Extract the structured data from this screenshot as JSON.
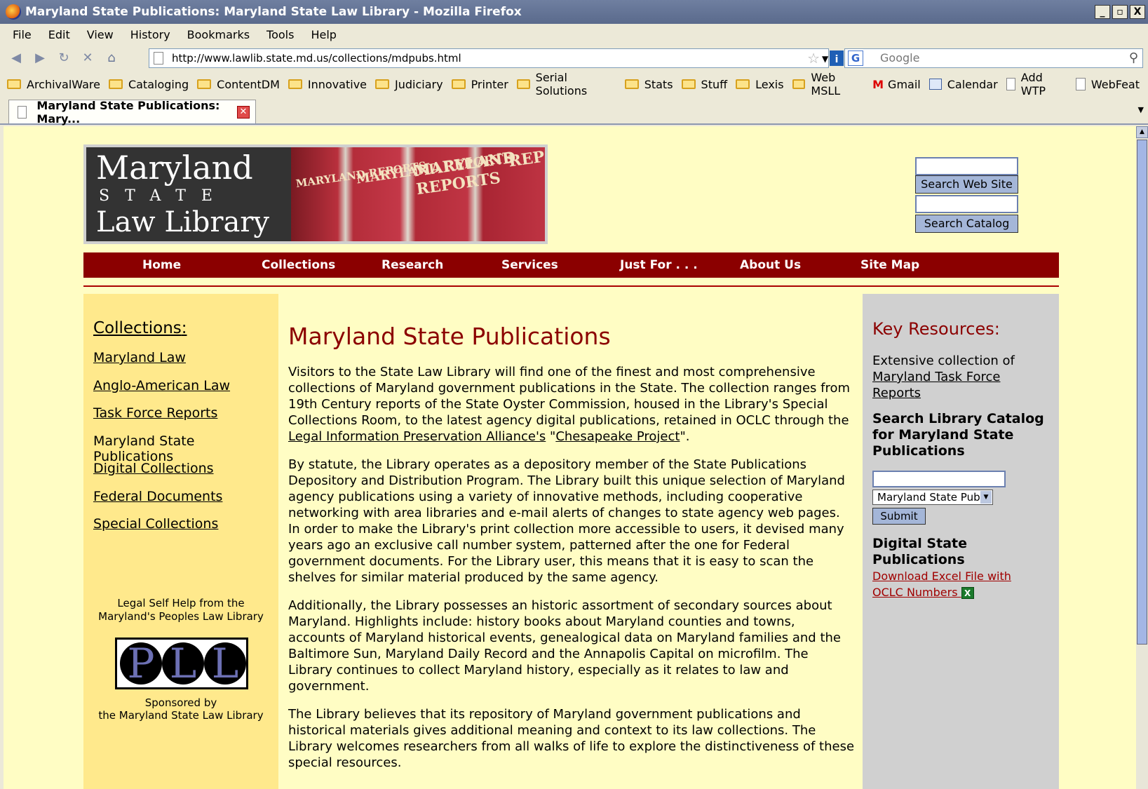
{
  "window": {
    "title": "Maryland State Publications: Maryland State Law Library - Mozilla Firefox",
    "controls": [
      "_",
      "▫",
      "X"
    ]
  },
  "menu": [
    "File",
    "Edit",
    "View",
    "History",
    "Bookmarks",
    "Tools",
    "Help"
  ],
  "nav": {
    "url": "http://www.lawlib.state.md.us/collections/mdpubs.html",
    "search_placeholder": "Google",
    "search_engine_icon": "G"
  },
  "bookmarks": [
    {
      "label": "ArchivalWare",
      "icon": "folder-icon"
    },
    {
      "label": "Cataloging",
      "icon": "folder-icon"
    },
    {
      "label": "ContentDM",
      "icon": "folder-icon"
    },
    {
      "label": "Innovative",
      "icon": "folder-icon"
    },
    {
      "label": "Judiciary",
      "icon": "folder-icon"
    },
    {
      "label": "Printer",
      "icon": "folder-icon"
    },
    {
      "label": "Serial Solutions",
      "icon": "folder-icon"
    },
    {
      "label": "Stats",
      "icon": "folder-icon"
    },
    {
      "label": "Stuff",
      "icon": "folder-icon"
    },
    {
      "label": "Lexis",
      "icon": "folder-icon"
    },
    {
      "label": "Web MSLL",
      "icon": "folder-icon"
    },
    {
      "label": "Gmail",
      "icon": "gmail-icon"
    },
    {
      "label": "Calendar",
      "icon": "calendar-icon"
    },
    {
      "label": "Add WTP",
      "icon": "page-icon"
    },
    {
      "label": "WebFeat",
      "icon": "page-icon"
    }
  ],
  "tab": {
    "title": "Maryland State Publications: Mary..."
  },
  "site": {
    "logo": {
      "line1": "Maryland",
      "line2": "STATE",
      "line3": "Law Library",
      "spine1": "MARYLAND REPORTS",
      "spine2": "MARYLAND REPORTS",
      "spine3": "MARYLAND REPORTS",
      "spine4": "REP"
    },
    "search_web_button": "Search Web Site",
    "search_catalog_button": "Search Catalog",
    "nav": [
      "Home",
      "Collections",
      "Research",
      "Services",
      "Just For . . .",
      "About Us",
      "Site Map"
    ],
    "left": {
      "heading": "Collections",
      "heading_colon": ":",
      "links": [
        "Maryland Law",
        "Anglo-American Law",
        "Task Force Reports",
        "Maryland State Publications",
        "Digital Collections",
        "Federal Documents",
        "Special Collections"
      ],
      "pll_caption": "Legal Self Help from the Maryland's Peoples Law Library",
      "pll_logo": "PLL",
      "sponsor_line1": "Sponsored by",
      "sponsor_line2": "the Maryland State Law Library"
    },
    "main": {
      "title": "Maryland State Publications",
      "p1_a": "Visitors to the State Law Library will find one of the finest and most comprehensive collections of Maryland government publications in the State. The collection ranges from 19th Century reports of the State Oyster Commission, housed in the Library's Special Collections Room, to the latest agency digital publications, retained in OCLC through the ",
      "p1_link1": "Legal Information Preservation Alliance's",
      "p1_b": " \"",
      "p1_link2": "Chesapeake Project",
      "p1_c": "\".",
      "p2": "By statute, the Library operates as a depository member of the State Publications Depository and Distribution Program. The Library built this unique selection of Maryland agency publications using a variety of innovative methods, including cooperative networking with area libraries and e-mail alerts of changes to state agency web pages. In order to make the Library's print collection more accessible to users, it devised many years ago an exclusive call number system, patterned after the one for Federal government documents. For the Library user, this means that it is easy to scan the shelves for similar material produced by the same agency.",
      "p3": "Additionally, the Library possesses an historic assortment of secondary sources about Maryland. Highlights include: history books about Maryland counties and towns, accounts of Maryland historical events, genealogical data on Maryland families and the Baltimore Sun, Maryland Daily Record and the Annapolis Capital on microfilm. The Library continues to collect Maryland history, especially as it relates to law and government.",
      "p4": "The Library believes that its repository of Maryland government publications and historical materials gives additional meaning and context to its law collections. The Library welcomes researchers from all walks of life to explore the distinctiveness of these special resources."
    },
    "right": {
      "heading": "Key Resources:",
      "extensive": "Extensive collection of",
      "task_force_link": "Maryland Task Force Reports",
      "search_heading": "Search Library Catalog for Maryland State Publications",
      "select_value": "Maryland State Pubs",
      "submit": "Submit",
      "digital_heading": "Digital State Publications",
      "download_link": "Download Excel File with OCLC Numbers"
    }
  },
  "colors": {
    "nav_red": "#8b0000",
    "page_bg": "#fffdc4",
    "left_bg": "#ffe98c",
    "right_bg": "#d0d0d0",
    "link_red": "#a00000"
  }
}
